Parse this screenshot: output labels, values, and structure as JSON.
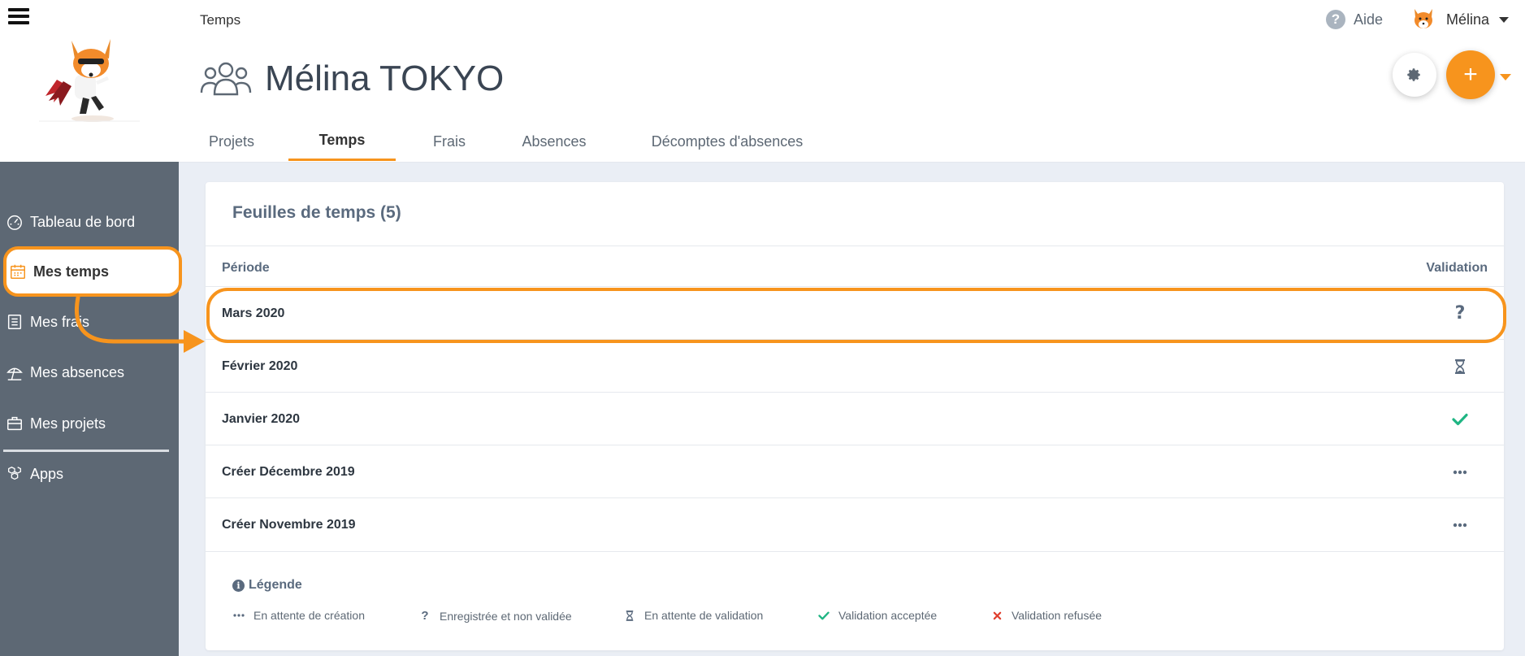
{
  "sidebar": {
    "items": [
      {
        "label": "Tableau de bord",
        "icon": "speedometer-icon"
      },
      {
        "label": "Mes temps",
        "icon": "calendar-icon",
        "active": true
      },
      {
        "label": "Mes frais",
        "icon": "receipt-icon"
      },
      {
        "label": "Mes absences",
        "icon": "beach-umbrella-icon"
      },
      {
        "label": "Mes projets",
        "icon": "briefcase-icon"
      },
      {
        "label": "Apps",
        "icon": "cubes-icon"
      }
    ]
  },
  "header": {
    "breadcrumb": "Temps",
    "help_label": "Aide",
    "user_name": "Mélina",
    "page_title": "Mélina TOKYO",
    "add_label": "+"
  },
  "tabs": [
    {
      "label": "Projets"
    },
    {
      "label": "Temps",
      "active": true
    },
    {
      "label": "Frais"
    },
    {
      "label": "Absences"
    },
    {
      "label": "Décomptes d'absences"
    }
  ],
  "card": {
    "title": "Feuilles de temps (5)",
    "col_period": "Période",
    "col_validation": "Validation",
    "rows": [
      {
        "period": "Mars 2020",
        "status": "question-icon"
      },
      {
        "period": "Février 2020",
        "status": "hourglass-icon"
      },
      {
        "period": "Janvier 2020",
        "status": "check-icon"
      },
      {
        "period": "Créer Décembre 2019",
        "status": "ellipsis-icon"
      },
      {
        "period": "Créer Novembre 2019",
        "status": "ellipsis-icon"
      }
    ],
    "legend": {
      "title": "Légende",
      "items": [
        {
          "label": "En attente de création",
          "icon": "ellipsis-icon"
        },
        {
          "label": "Enregistrée et non validée",
          "icon": "question-icon"
        },
        {
          "label": "En attente de validation",
          "icon": "hourglass-icon"
        },
        {
          "label": "Validation acceptée",
          "icon": "check-icon"
        },
        {
          "label": "Validation refusée",
          "icon": "cross-icon"
        }
      ]
    }
  },
  "colors": {
    "accent": "#f7941d",
    "sidebar": "#5d6874",
    "success": "#1fb583",
    "danger": "#e0402f"
  }
}
